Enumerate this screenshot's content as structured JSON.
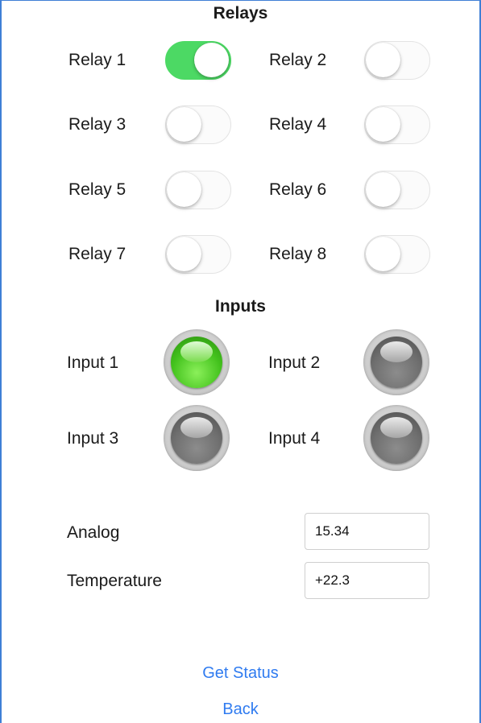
{
  "relays": {
    "title": "Relays",
    "items": [
      {
        "label": "Relay 1",
        "on": true
      },
      {
        "label": "Relay 2",
        "on": false
      },
      {
        "label": "Relay 3",
        "on": false
      },
      {
        "label": "Relay 4",
        "on": false
      },
      {
        "label": "Relay 5",
        "on": false
      },
      {
        "label": "Relay 6",
        "on": false
      },
      {
        "label": "Relay 7",
        "on": false
      },
      {
        "label": "Relay 8",
        "on": false
      }
    ]
  },
  "inputs": {
    "title": "Inputs",
    "items": [
      {
        "label": "Input 1",
        "active": true
      },
      {
        "label": "Input 2",
        "active": false
      },
      {
        "label": "Input 3",
        "active": false
      },
      {
        "label": "Input 4",
        "active": false
      }
    ]
  },
  "readings": {
    "analog": {
      "label": "Analog",
      "value": "15.34"
    },
    "temperature": {
      "label": "Temperature",
      "value": "+22.3"
    }
  },
  "actions": {
    "get_status": "Get Status",
    "back": "Back"
  },
  "colors": {
    "switch_on": "#4cd964",
    "led_active": "#43c21d",
    "link": "#2f7bf0"
  }
}
